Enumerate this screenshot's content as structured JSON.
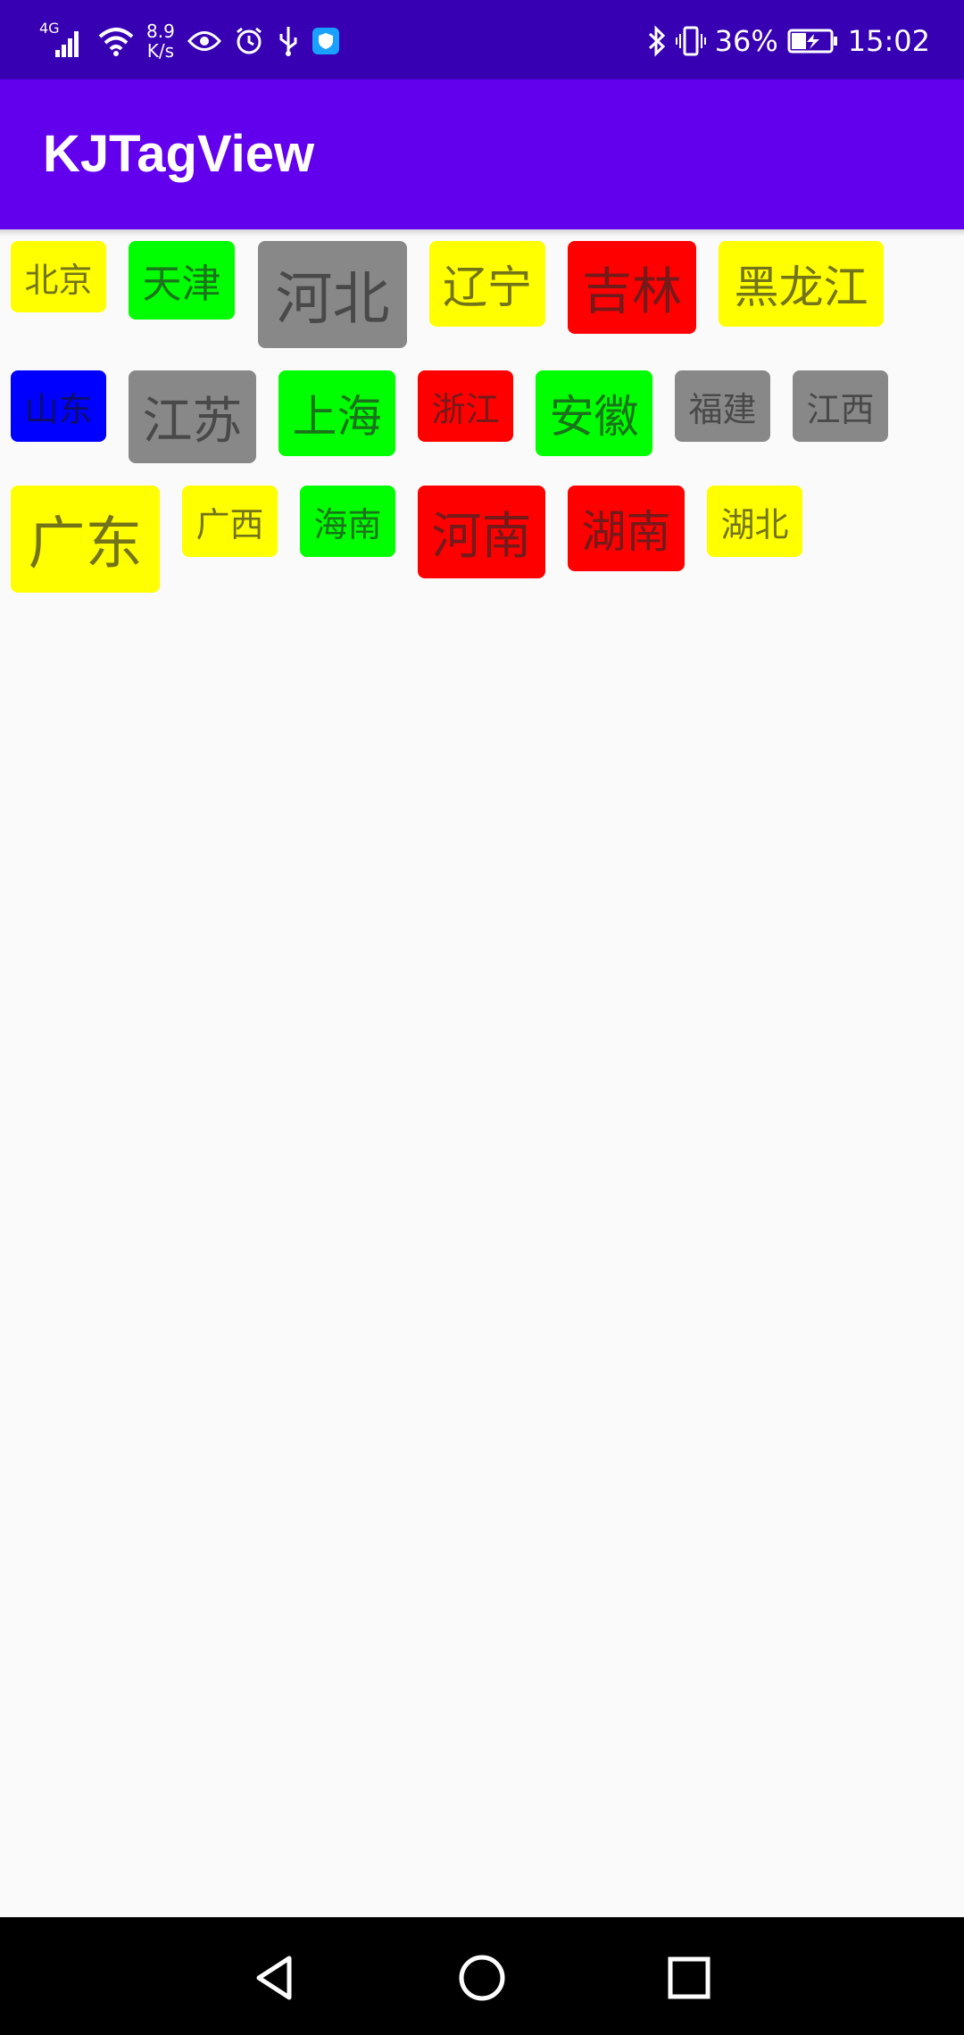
{
  "status_bar": {
    "network_type": "4G",
    "speed_value": "8.9",
    "speed_unit": "K/s",
    "battery": "36%",
    "time": "15:02"
  },
  "app_bar": {
    "title": "KJTagView"
  },
  "tags": [
    {
      "label": "北京",
      "color": "#ffff00"
    },
    {
      "label": "天津",
      "color": "#00ff00"
    },
    {
      "label": "河北",
      "color": "#888888"
    },
    {
      "label": "辽宁",
      "color": "#ffff00"
    },
    {
      "label": "吉林",
      "color": "#ff0000"
    },
    {
      "label": "黑龙江",
      "color": "#ffff00"
    },
    {
      "label": "山东",
      "color": "#0000ff"
    },
    {
      "label": "江苏",
      "color": "#888888"
    },
    {
      "label": "上海",
      "color": "#00ff00"
    },
    {
      "label": "浙江",
      "color": "#ff0000"
    },
    {
      "label": "安徽",
      "color": "#00ff00"
    },
    {
      "label": "福建",
      "color": "#888888"
    },
    {
      "label": "江西",
      "color": "#888888"
    },
    {
      "label": "广东",
      "color": "#ffff00"
    },
    {
      "label": "广西",
      "color": "#ffff00"
    },
    {
      "label": "海南",
      "color": "#00ff00"
    },
    {
      "label": "河南",
      "color": "#ff0000"
    },
    {
      "label": "湖南",
      "color": "#ff0000"
    },
    {
      "label": "湖北",
      "color": "#ffff00"
    }
  ],
  "nav_bar": {
    "back_icon": "triangle-back-icon",
    "home_icon": "circle-home-icon",
    "recents_icon": "square-recents-icon"
  }
}
